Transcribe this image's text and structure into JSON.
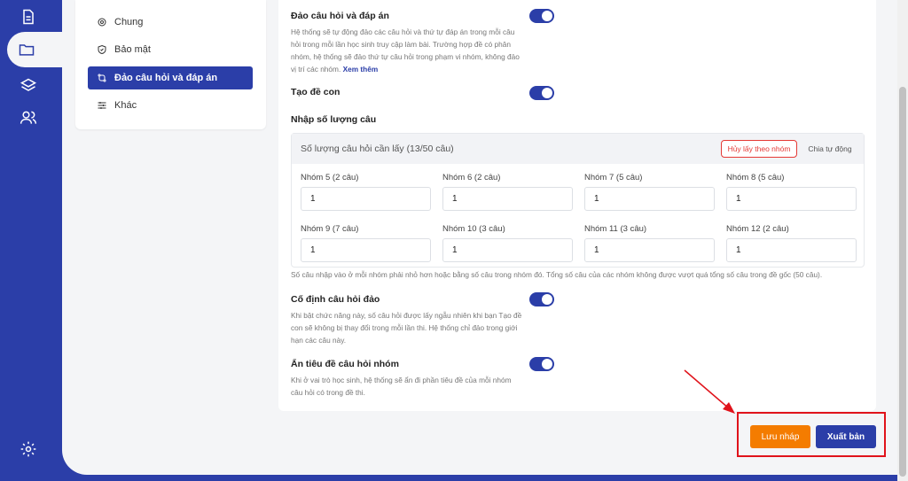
{
  "menu": {
    "items": [
      {
        "label": "Chung",
        "icon": "gear-icon"
      },
      {
        "label": "Bảo mật",
        "icon": "shield-icon"
      },
      {
        "label": "Đảo câu hỏi và đáp án",
        "icon": "shuffle-icon"
      },
      {
        "label": "Khác",
        "icon": "sliders-icon"
      }
    ],
    "active_index": 2
  },
  "settings": {
    "shuffle": {
      "title": "Đảo câu hỏi và đáp án",
      "desc": "Hệ thống sẽ tự động đảo các câu hỏi và thứ tự đáp án trong mỗi câu hỏi trong mỗi lần học sinh truy cập làm bài. Trường hợp đề có phân nhóm, hệ thống sẽ đảo thứ tự câu hỏi trong phạm vi nhóm, không đảo vị trí các nhóm.",
      "more": "Xem thêm",
      "enabled": true
    },
    "sub_exam": {
      "title": "Tạo đề con",
      "enabled": true
    },
    "count_section": {
      "title": "Nhập số lượng câu",
      "header": "Số lượng câu hỏi cần lấy (13/50 câu)",
      "cancel_group_label": "Hủy lấy theo nhóm",
      "auto_split_label": "Chia tự động",
      "groups": [
        {
          "label": "Nhóm 5 (2 câu)",
          "value": "1"
        },
        {
          "label": "Nhóm 6 (2 câu)",
          "value": "1"
        },
        {
          "label": "Nhóm 7 (5 câu)",
          "value": "1"
        },
        {
          "label": "Nhóm 8 (5 câu)",
          "value": "1"
        },
        {
          "label": "Nhóm 9 (7 câu)",
          "value": "1"
        },
        {
          "label": "Nhóm 10 (3 câu)",
          "value": "1"
        },
        {
          "label": "Nhóm 11 (3 câu)",
          "value": "1"
        },
        {
          "label": "Nhóm 12 (2 câu)",
          "value": "1"
        }
      ],
      "note": "Số câu nhập vào ở mỗi nhóm phải nhỏ hơn hoặc bằng số câu trong nhóm đó. Tổng số câu của các nhóm không được vượt quá tổng số câu trong đề gốc (50 câu)."
    },
    "fix_shuffle": {
      "title": "Cố định câu hỏi đảo",
      "desc": "Khi bật chức năng này, số câu hỏi được lấy ngẫu nhiên khi bạn Tạo đề con sẽ không bị thay đổi trong mỗi lần thi. Hệ thống chỉ đảo trong giới hạn các câu này.",
      "enabled": true
    },
    "hide_group_title": {
      "title": "Ẩn tiêu đề câu hỏi nhóm",
      "desc": "Khi ở vai trò học sinh, hệ thống sẽ ẩn đi phần tiêu đề của mỗi nhóm câu hỏi có trong đề thi.",
      "enabled": true
    }
  },
  "actions": {
    "save_draft": "Lưu nháp",
    "publish": "Xuất bản"
  },
  "colors": {
    "primary": "#2b3ea8",
    "orange": "#f47c00",
    "red": "#e0131b"
  }
}
